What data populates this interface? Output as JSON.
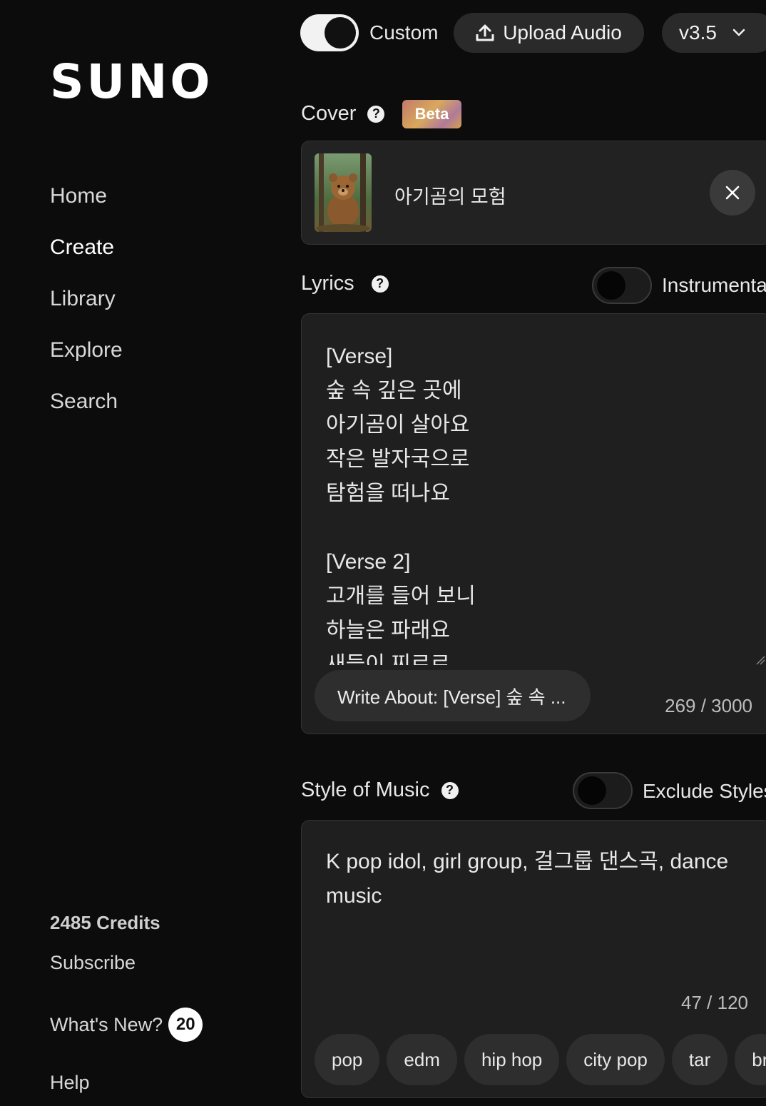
{
  "sidebar": {
    "logo": "SUNO",
    "nav": [
      {
        "label": "Home"
      },
      {
        "label": "Create"
      },
      {
        "label": "Library"
      },
      {
        "label": "Explore"
      },
      {
        "label": "Search"
      }
    ],
    "credits": "2485 Credits",
    "subscribe": "Subscribe",
    "whats_new": "What's New?",
    "whats_new_count": "20",
    "help": "Help"
  },
  "topbar": {
    "custom_label": "Custom",
    "custom_on": true,
    "upload_label": "Upload Audio",
    "version": "v3.5"
  },
  "cover": {
    "label": "Cover",
    "beta": "Beta",
    "title": "아기곰의 모험"
  },
  "lyrics": {
    "label": "Lyrics",
    "instrumental_label": "Instrumental",
    "instrumental_on": false,
    "text": "[Verse]\n숲 속 깊은 곳에\n아기곰이 살아요\n작은 발자국으로\n탐험을 떠나요\n\n[Verse 2]\n고개를 들어 보니\n하늘은 파래요\n새들이 찌르르",
    "write_about": "Write About: [Verse] 숲 속 ...",
    "count": "269 / 3000"
  },
  "style": {
    "label": "Style of Music",
    "exclude_label": "Exclude Styles",
    "exclude_on": false,
    "text": "K pop idol, girl group, 걸그룹 댄스곡, dance music",
    "count": "47 / 120",
    "chips": [
      "pop",
      "edm",
      "hip hop",
      "city pop",
      "tar",
      "br"
    ]
  },
  "colors": {
    "background": "#0c0c0c",
    "panel": "#1f1f1f",
    "button": "#2a2a2a"
  }
}
